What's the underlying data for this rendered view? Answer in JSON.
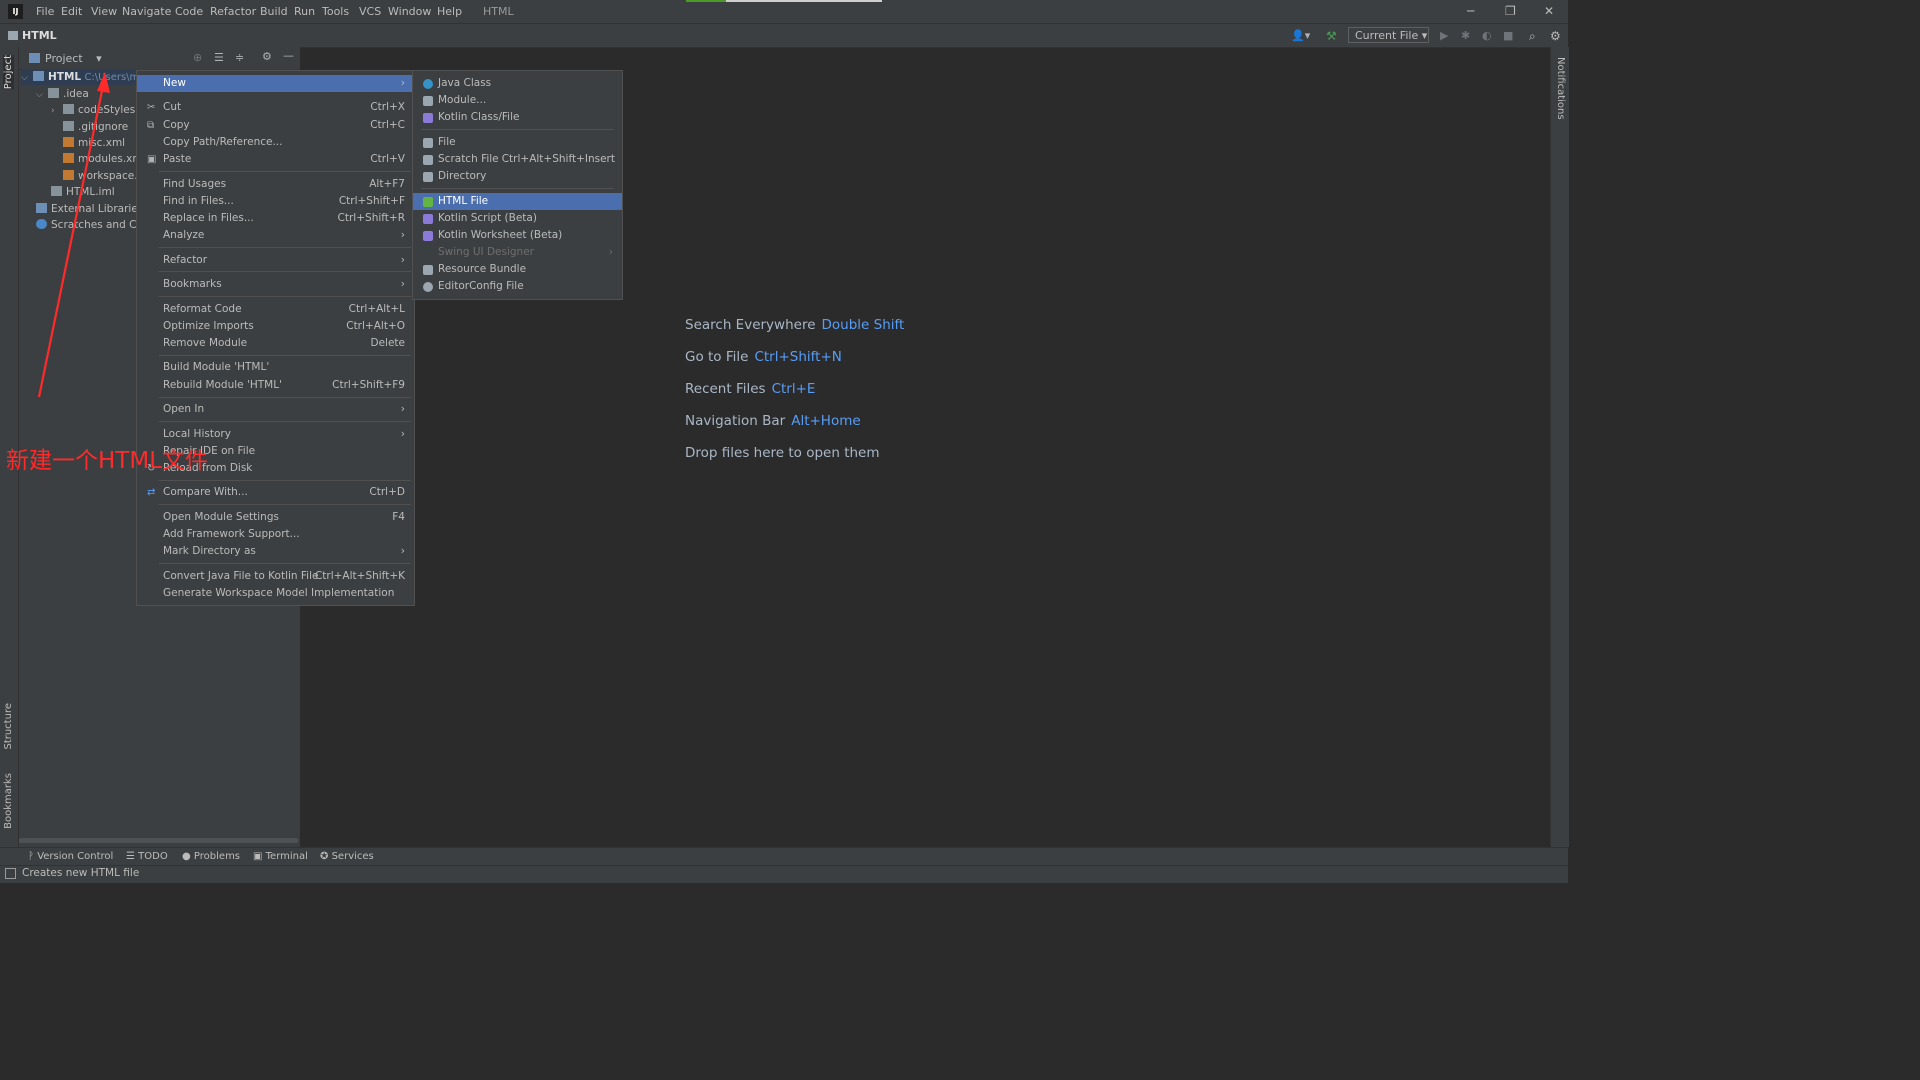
{
  "window": {
    "title": "HTML",
    "menu": [
      "File",
      "Edit",
      "View",
      "Navigate",
      "Code",
      "Refactor",
      "Build",
      "Run",
      "Tools",
      "VCS",
      "Window",
      "Help"
    ],
    "controls": {
      "minimize": "─",
      "restore": "❐",
      "close": "✕"
    }
  },
  "navbar": {
    "project_name": "HTML",
    "run_config": "Current File"
  },
  "stripes": {
    "project": "Project",
    "structure": "Structure",
    "bookmarks": "Bookmarks",
    "notifications": "Notifications"
  },
  "project_panel": {
    "header": "Project",
    "tree": [
      {
        "label": "HTML",
        "extra": "C:\\Users\\m",
        "level": 0,
        "icon": "module-folder-icon"
      },
      {
        "label": ".idea",
        "level": 1,
        "icon": "folder-icon"
      },
      {
        "label": "codeStyles",
        "level": 2,
        "icon": "folder-icon"
      },
      {
        "label": ".gitignore",
        "level": 2,
        "icon": "file-icon"
      },
      {
        "label": "misc.xml",
        "level": 2,
        "icon": "xml-icon"
      },
      {
        "label": "modules.xm",
        "level": 2,
        "icon": "xml-icon"
      },
      {
        "label": "workspace.",
        "level": 2,
        "icon": "xml-icon"
      },
      {
        "label": "HTML.iml",
        "level": 1,
        "icon": "iml-icon"
      },
      {
        "label": "External Libraries",
        "level": 0,
        "icon": "library-icon"
      },
      {
        "label": "Scratches and Co",
        "level": 0,
        "icon": "scratch-icon"
      }
    ]
  },
  "context_menu": {
    "items": [
      {
        "label": "New",
        "arrow": true,
        "selected": true
      },
      {
        "label": "Cut",
        "shortcut": "Ctrl+X",
        "icon": "✂"
      },
      {
        "label": "Copy",
        "shortcut": "Ctrl+C",
        "icon": "⧉"
      },
      {
        "label": "Copy Path/Reference..."
      },
      {
        "label": "Paste",
        "shortcut": "Ctrl+V",
        "icon": "▣"
      },
      {
        "label": "Find Usages",
        "shortcut": "Alt+F7"
      },
      {
        "label": "Find in Files...",
        "shortcut": "Ctrl+Shift+F"
      },
      {
        "label": "Replace in Files...",
        "shortcut": "Ctrl+Shift+R"
      },
      {
        "label": "Analyze",
        "arrow": true
      },
      {
        "label": "Refactor",
        "arrow": true
      },
      {
        "label": "Bookmarks",
        "arrow": true
      },
      {
        "label": "Reformat Code",
        "shortcut": "Ctrl+Alt+L"
      },
      {
        "label": "Optimize Imports",
        "shortcut": "Ctrl+Alt+O"
      },
      {
        "label": "Remove Module",
        "shortcut": "Delete"
      },
      {
        "label": "Build Module 'HTML'"
      },
      {
        "label": "Rebuild Module 'HTML'",
        "shortcut": "Ctrl+Shift+F9"
      },
      {
        "label": "Open In",
        "arrow": true
      },
      {
        "label": "Local History",
        "arrow": true
      },
      {
        "label": "Repair IDE on File"
      },
      {
        "label": "Reload from Disk",
        "icon": "↻"
      },
      {
        "label": "Compare With...",
        "shortcut": "Ctrl+D",
        "icon": "⇄"
      },
      {
        "label": "Open Module Settings",
        "shortcut": "F4"
      },
      {
        "label": "Add Framework Support..."
      },
      {
        "label": "Mark Directory as",
        "arrow": true
      },
      {
        "label": "Convert Java File to Kotlin File",
        "shortcut": "Ctrl+Alt+Shift+K"
      },
      {
        "label": "Generate Workspace Model Implementation"
      }
    ]
  },
  "submenu": {
    "items": [
      {
        "label": "Java Class",
        "color": "#3592c4"
      },
      {
        "label": "Module...",
        "color": "#9aa7b0"
      },
      {
        "label": "Kotlin Class/File",
        "color": "#8c7ad8"
      },
      {
        "label": "File",
        "color": "#9aa7b0"
      },
      {
        "label": "Scratch File",
        "shortcut": "Ctrl+Alt+Shift+Insert",
        "color": "#9aa7b0"
      },
      {
        "label": "Directory",
        "color": "#9aa7b0"
      },
      {
        "label": "HTML File",
        "selected": true,
        "color": "#62b543"
      },
      {
        "label": "Kotlin Script (Beta)",
        "color": "#8c7ad8"
      },
      {
        "label": "Kotlin Worksheet (Beta)",
        "color": "#8c7ad8"
      },
      {
        "label": "Swing UI Designer",
        "disabled": true,
        "arrow": true
      },
      {
        "label": "Resource Bundle",
        "color": "#9aa7b0"
      },
      {
        "label": "EditorConfig File",
        "color": "#9aa7b0"
      }
    ]
  },
  "welcome": {
    "hints": [
      {
        "text": "Search Everywhere",
        "key": "Double Shift"
      },
      {
        "text": "Go to File",
        "key": "Ctrl+Shift+N"
      },
      {
        "text": "Recent Files",
        "key": "Ctrl+E"
      },
      {
        "text": "Navigation Bar",
        "key": "Alt+Home"
      },
      {
        "text": "Drop files here to open them",
        "key": ""
      }
    ]
  },
  "annotation": {
    "text": "新建一个HTML文件",
    "color": "#ff2a2a"
  },
  "tool_windows": [
    "Version Control",
    "TODO",
    "Problems",
    "Terminal",
    "Services"
  ],
  "status": {
    "text": "Creates new HTML file"
  }
}
